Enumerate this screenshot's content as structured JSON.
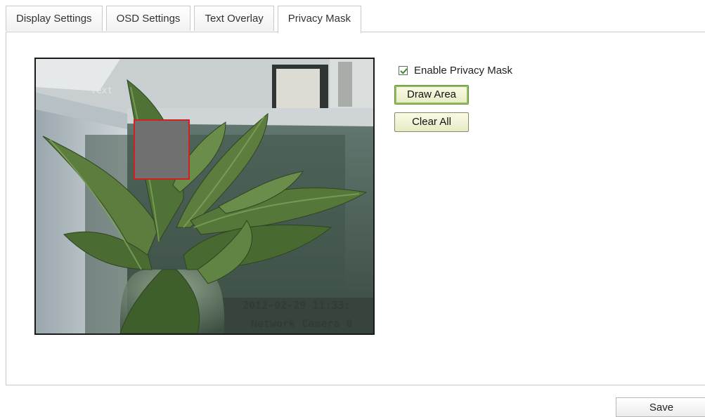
{
  "tabs": [
    {
      "label": "Display Settings",
      "active": false
    },
    {
      "label": "OSD Settings",
      "active": false
    },
    {
      "label": "Text Overlay",
      "active": false
    },
    {
      "label": "Privacy Mask",
      "active": true
    }
  ],
  "video": {
    "osd_name": "Text",
    "osd_datetime": "2012-02-29 11:33:",
    "osd_camera_name": "Network Camera 0"
  },
  "privacy_mask": {
    "enable_label": "Enable Privacy Mask",
    "enabled": true,
    "draw_area_label": "Draw Area",
    "clear_all_label": "Clear All"
  },
  "footer": {
    "save_label": "Save"
  },
  "colors": {
    "mask_fill": "#707070",
    "mask_border": "#d41f1f",
    "check_mark": "#3a8a2a",
    "button_border": "#6f8f4a"
  }
}
